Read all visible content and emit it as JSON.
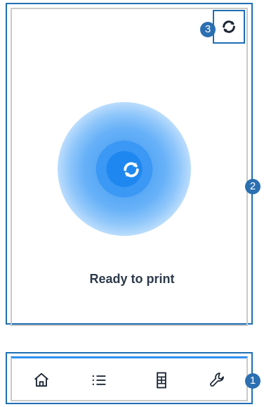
{
  "badges": [
    "1",
    "2",
    "3"
  ],
  "main": {
    "status": "Ready to print",
    "sync_icon": "sync-icon",
    "top_sync_icon": "sync-icon"
  },
  "nav": {
    "items": [
      {
        "icon": "home-icon"
      },
      {
        "icon": "list-icon"
      },
      {
        "icon": "film-icon"
      },
      {
        "icon": "wrench-icon"
      }
    ],
    "accent_color": "#2f8ff0"
  },
  "colors": {
    "glow": "#1e88f0",
    "annotation": "#1f6fb5",
    "text": "#2c3a4b"
  }
}
